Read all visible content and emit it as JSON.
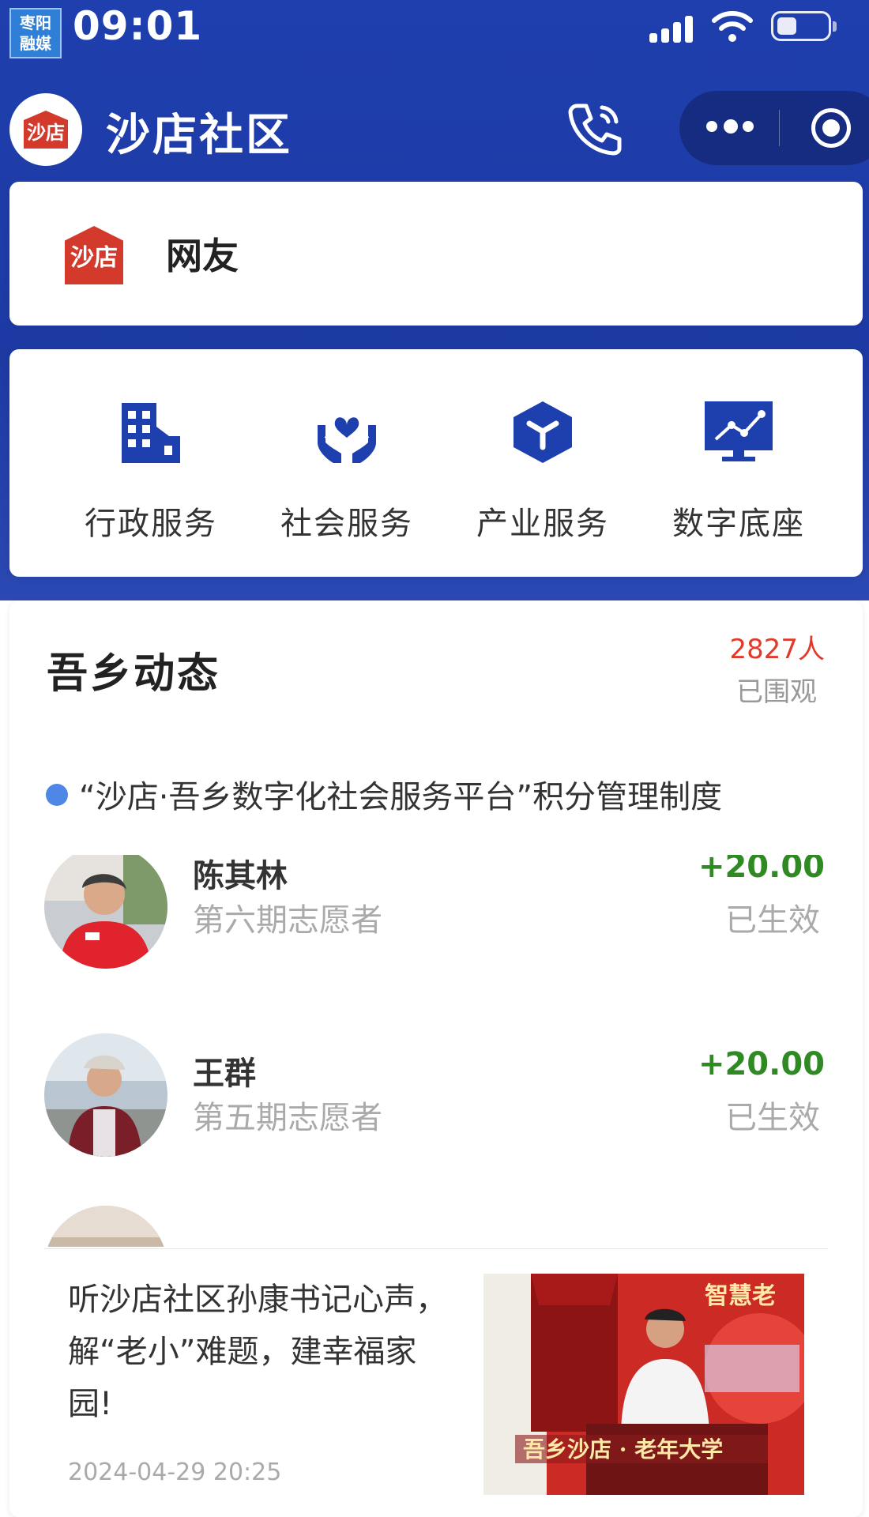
{
  "status_bar": {
    "media_logo_line1": "枣阳",
    "media_logo_line2": "融媒",
    "time": "09:01"
  },
  "header": {
    "title": "沙店社区",
    "logo_text": "沙店"
  },
  "user": {
    "name": "网友",
    "logo_text": "沙店"
  },
  "services": [
    {
      "label": "行政服务",
      "icon": "building-icon"
    },
    {
      "label": "社会服务",
      "icon": "care-heart-icon"
    },
    {
      "label": "产业服务",
      "icon": "cube-icon"
    },
    {
      "label": "数字底座",
      "icon": "monitor-chart-icon"
    }
  ],
  "news": {
    "title": "吾乡动态",
    "views_count": "2827人",
    "views_label": "已围观",
    "notice": "“沙店·吾乡数字化社会服务平台”积分管理制度",
    "volunteers": [
      {
        "name": "陈其林",
        "role": "第六期志愿者",
        "points": "+20.00",
        "status": "已生效"
      },
      {
        "name": "王群",
        "role": "第五期志愿者",
        "points": "+20.00",
        "status": "已生效"
      }
    ],
    "article": {
      "title": "听沙店社区孙康书记心声，解“老小”难题，建幸福家园!",
      "time": "2024-04-29 20:25",
      "thumb_banner": "吾乡沙店 · 老年大学",
      "thumb_top_text": "智慧老"
    }
  },
  "colors": {
    "header_blue": "#1f3fae",
    "accent_red": "#e23a2a",
    "points_green": "#2f8a24",
    "notice_dot": "#4f87e6"
  }
}
